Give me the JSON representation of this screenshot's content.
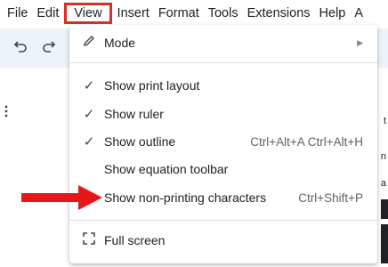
{
  "menubar": {
    "items": [
      "File",
      "Edit",
      "View",
      "Insert",
      "Format",
      "Tools",
      "Extensions",
      "Help",
      "A"
    ],
    "active": "View"
  },
  "toolbar": {
    "undo_icon": "undo-icon",
    "redo_icon": "redo-icon"
  },
  "menu": {
    "mode": {
      "label": "Mode",
      "icon": "pencil-icon"
    },
    "show_print_layout": {
      "label": "Show print layout",
      "checked": true
    },
    "show_ruler": {
      "label": "Show ruler",
      "checked": true
    },
    "show_outline": {
      "label": "Show outline",
      "checked": true,
      "shortcut": "Ctrl+Alt+A Ctrl+Alt+H"
    },
    "show_equation_toolbar": {
      "label": "Show equation toolbar",
      "checked": false
    },
    "show_non_printing": {
      "label": "Show non-printing characters",
      "checked": false,
      "shortcut": "Ctrl+Shift+P"
    },
    "full_screen": {
      "label": "Full screen",
      "icon": "fullscreen-icon"
    }
  },
  "right_edge_text": {
    "c1": "t",
    "c2": "n",
    "c3": "a"
  },
  "colors": {
    "highlight": "#d93025",
    "arrow": "#e8161b",
    "toolbar_bg": "#eef2f9"
  }
}
